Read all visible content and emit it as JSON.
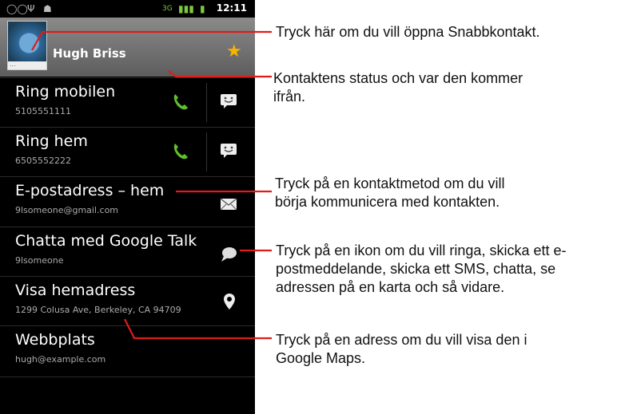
{
  "phone": {
    "status": {
      "time": "12:11"
    },
    "contact": {
      "name": "Hugh Briss",
      "avatar_footer": "..."
    },
    "rows": [
      {
        "title": "Ring mobilen",
        "subtitle": "5105551111",
        "action_icon": "phone-icon",
        "secondary_icon": "sms-icon"
      },
      {
        "title": "Ring hem",
        "subtitle": "6505552222",
        "action_icon": "phone-icon",
        "secondary_icon": "sms-icon"
      },
      {
        "title": "E-postadress – hem",
        "subtitle": "9lsomeone@gmail.com",
        "action_icon": "email-icon"
      },
      {
        "title": "Chatta med Google Talk",
        "subtitle": "9lsomeone",
        "action_icon": "chat-icon"
      },
      {
        "title": "Visa hemadress",
        "subtitle": "1299 Colusa Ave, Berkeley, CA 94709",
        "action_icon": "map-pin-icon"
      },
      {
        "title": "Webbplats",
        "subtitle": "hugh@example.com"
      }
    ]
  },
  "annotations": {
    "quick_contact": "Tryck här om du vill öppna Snabbkontakt.",
    "status_line1": "Kontaktens status och var den kommer",
    "status_line2": "ifrån.",
    "method_line1": "Tryck på en kontaktmetod om du vill",
    "method_line2": "börja kommunicera med kontakten.",
    "icon_line1": "Tryck på en ikon om du vill ringa, skicka ett e-",
    "icon_line2": "postmeddelande, skicka ett SMS, chatta, se",
    "icon_line3": "adressen på en karta och så vidare.",
    "address_line1": "Tryck på en adress om du vill visa den i",
    "address_line2": "Google Maps."
  },
  "colors": {
    "callout": "#e01b1b",
    "phone_green": "#5fbf2c",
    "star": "#f4b400"
  }
}
